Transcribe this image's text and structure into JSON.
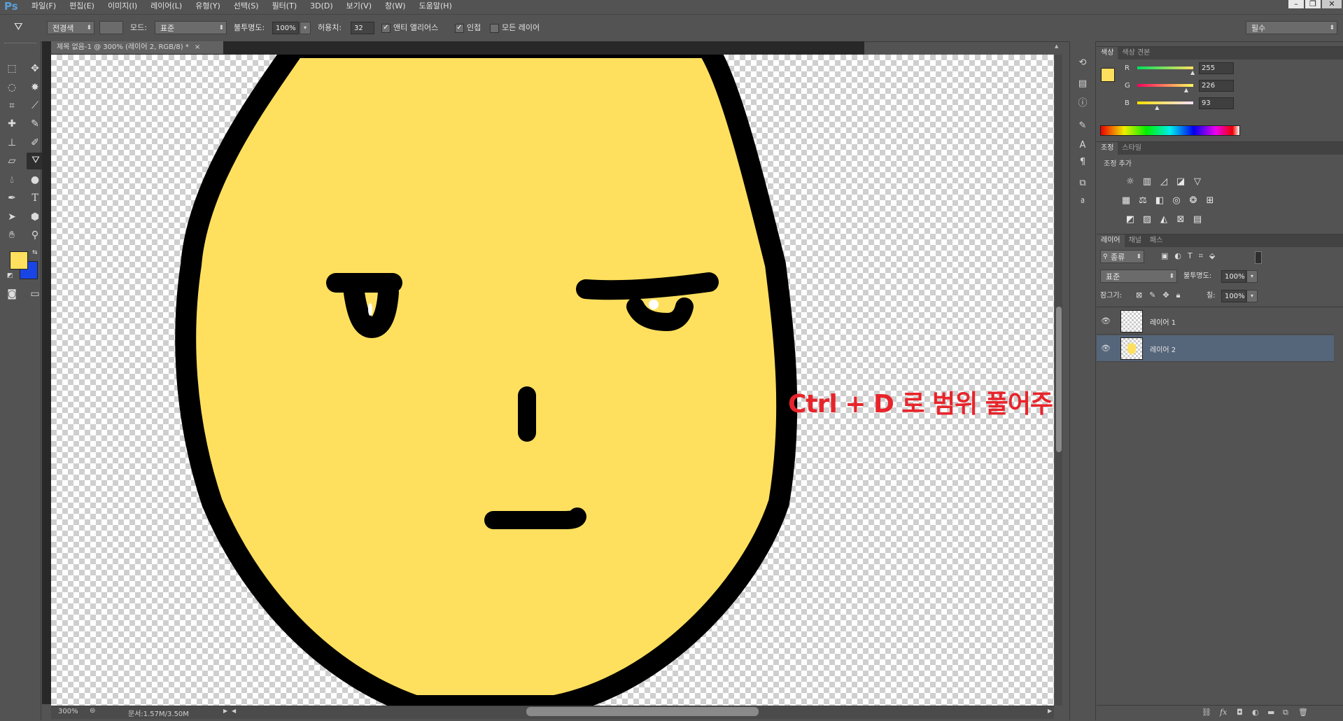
{
  "app": {
    "logo": "Ps"
  },
  "menu": [
    "파일(F)",
    "편집(E)",
    "이미지(I)",
    "레이어(L)",
    "유형(Y)",
    "선택(S)",
    "필터(T)",
    "3D(D)",
    "보기(V)",
    "창(W)",
    "도움말(H)"
  ],
  "window_controls": [
    "–",
    "❐",
    "✕"
  ],
  "options": {
    "fill_source": "전경색",
    "mode_label": "모드:",
    "mode_value": "표준",
    "opacity_label": "불투명도:",
    "opacity_value": "100%",
    "tolerance_label": "허용치:",
    "tolerance_value": "32",
    "antialias_label": "앤티 앨리어스",
    "contiguous_label": "인접",
    "all_layers_label": "모든 레이어",
    "workspace": "필수"
  },
  "document": {
    "tab_title": "제목 없음-1 @ 300% (레이어 2, RGB/8) *",
    "zoom": "300%",
    "doc_info": "문서:1.57M/3.50M"
  },
  "canvas": {
    "annotation": "Ctrl + D 로 범위 풀어주기!",
    "annotation_color": "#e8242b",
    "face_color": "#ffe05e",
    "outline_color": "#000000"
  },
  "colors": {
    "foreground": "#ffe05e",
    "background": "#1a45e6"
  },
  "color_panel": {
    "tabs": [
      "색상",
      "색상 견본"
    ],
    "channels": [
      {
        "label": "R",
        "value": "255",
        "level": 1.0
      },
      {
        "label": "G",
        "value": "226",
        "level": 0.886
      },
      {
        "label": "B",
        "value": "93",
        "level": 0.365
      }
    ]
  },
  "adjust_panel": {
    "tabs": [
      "조정",
      "스타일"
    ],
    "heading": "조정 추가",
    "icons": [
      [
        "brightness-icon",
        "levels-icon",
        "curves-icon",
        "exposure-icon",
        "vibrance-icon"
      ],
      [
        "hue-saturation-icon",
        "color-balance-icon",
        "black-white-icon",
        "photo-filter-icon",
        "channel-mixer-icon",
        "color-lookup-icon"
      ],
      [
        "invert-icon",
        "posterize-icon",
        "threshold-icon",
        "selective-color-icon",
        "gradient-map-icon"
      ]
    ]
  },
  "layers_panel": {
    "tabs": [
      "레이어",
      "채널",
      "패스"
    ],
    "filter": "종류",
    "blend_mode": "표준",
    "opacity_label": "불투명도:",
    "opacity_value": "100%",
    "lock_label": "잠그기:",
    "fill_label": "칠:",
    "fill_value": "100%",
    "layers": [
      {
        "name": "레이어 1",
        "selected": false
      },
      {
        "name": "레이어 2",
        "selected": true
      }
    ]
  }
}
